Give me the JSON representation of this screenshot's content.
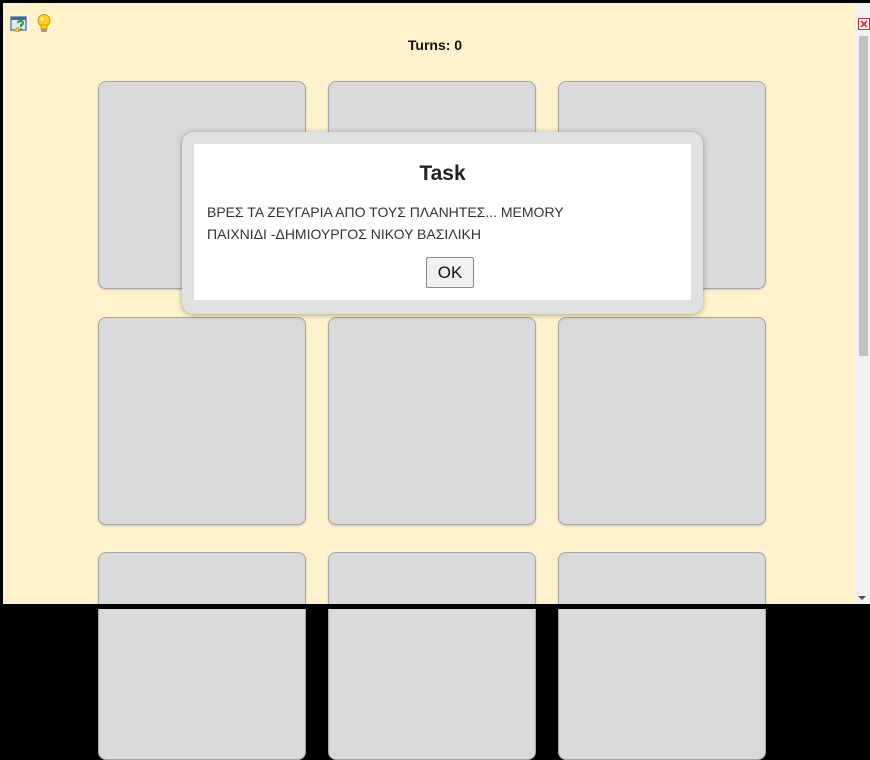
{
  "header": {
    "turns_label": "Turns: 0"
  },
  "toolbar": {
    "help_icon": "help-question-icon",
    "hint_icon": "lightbulb-icon",
    "close_icon": "close-icon"
  },
  "dialog": {
    "title": "Task",
    "message_line1": "ΒΡΕΣ ΤΑ ΖΕΥΓΑΡΙΑ ΑΠΟ ΤΟΥΣ ΠΛΑΝΗΤΕΣ... MEMORY",
    "message_line2": "ΠΑΙΧΝΙΔΙ -ΔΗΜΙΟΥΡΓΟΣ ΝΙΚΟΥ ΒΑΣΙΛΙΚΗ",
    "ok_label": "OK"
  },
  "colors": {
    "background": "#fff2cc",
    "card": "#d9d9d9",
    "card_border": "#a6a6a6",
    "dialog_frame": "#e0e0e0"
  }
}
